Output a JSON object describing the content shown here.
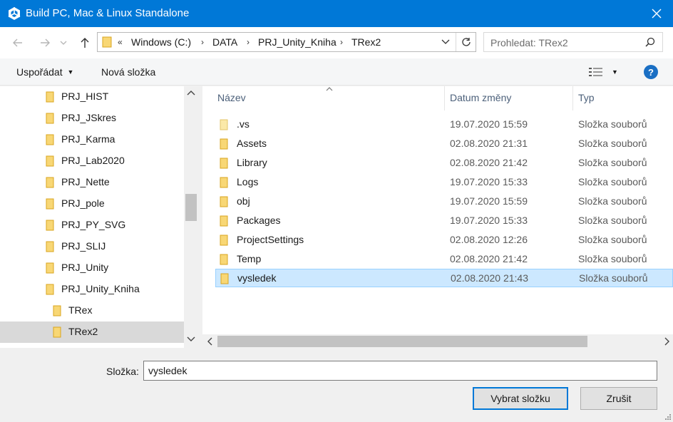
{
  "window": {
    "title": "Build PC, Mac & Linux Standalone"
  },
  "navigation": {
    "breadcrumb": [
      "Windows (C:)",
      "DATA",
      "PRJ_Unity_Kniha",
      "TRex2"
    ],
    "overflow": "«",
    "search_placeholder": "Prohledat: TRex2"
  },
  "toolbar": {
    "organize_label": "Uspořádat",
    "new_folder_label": "Nová složka",
    "help_label": "?"
  },
  "tree": {
    "items": [
      {
        "label": "PRJ_HIST"
      },
      {
        "label": "PRJ_JSkres"
      },
      {
        "label": "PRJ_Karma"
      },
      {
        "label": "PRJ_Lab2020"
      },
      {
        "label": "PRJ_Nette"
      },
      {
        "label": "PRJ_pole"
      },
      {
        "label": "PRJ_PY_SVG"
      },
      {
        "label": "PRJ_SLIJ"
      },
      {
        "label": "PRJ_Unity"
      },
      {
        "label": "PRJ_Unity_Kniha"
      },
      {
        "label": "TRex"
      },
      {
        "label": "TRex2",
        "selected": true
      }
    ]
  },
  "files": {
    "columns": {
      "name": "Název",
      "date": "Datum změny",
      "type": "Typ"
    },
    "rows": [
      {
        "name": ".vs",
        "date": "19.07.2020 15:59",
        "type": "Složka souborů"
      },
      {
        "name": "Assets",
        "date": "02.08.2020 21:31",
        "type": "Složka souborů"
      },
      {
        "name": "Library",
        "date": "02.08.2020 21:42",
        "type": "Složka souborů"
      },
      {
        "name": "Logs",
        "date": "19.07.2020 15:33",
        "type": "Složka souborů"
      },
      {
        "name": "obj",
        "date": "19.07.2020 15:59",
        "type": "Složka souborů"
      },
      {
        "name": "Packages",
        "date": "19.07.2020 15:33",
        "type": "Složka souborů"
      },
      {
        "name": "ProjectSettings",
        "date": "02.08.2020 12:26",
        "type": "Složka souborů"
      },
      {
        "name": "Temp",
        "date": "02.08.2020 21:42",
        "type": "Složka souborů"
      },
      {
        "name": "vysledek",
        "date": "02.08.2020 21:43",
        "type": "Složka souborů",
        "selected": true
      }
    ]
  },
  "footer": {
    "folder_label": "Složka:",
    "folder_value": "vysledek",
    "select_button": "Vybrat složku",
    "cancel_button": "Zrušit"
  },
  "colors": {
    "titlebar": "#0078d7",
    "selection": "#cce8ff",
    "folder": "#f8d775"
  },
  "icons": {
    "app": "unity-logo-icon",
    "close": "close-icon",
    "back": "arrow-left-icon",
    "forward": "arrow-right-icon",
    "up": "arrow-up-icon",
    "refresh": "refresh-icon",
    "search": "search-icon",
    "folder": "folder-icon",
    "view": "view-options-icon",
    "help": "help-icon"
  }
}
